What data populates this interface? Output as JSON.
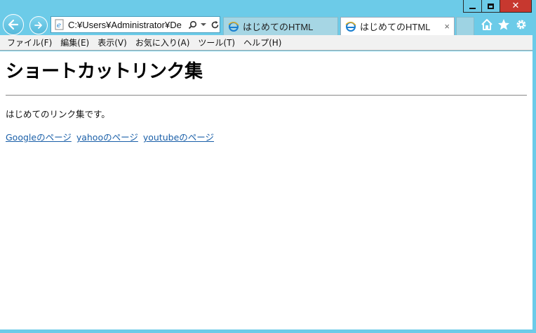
{
  "window": {
    "caption_buttons": [
      "minimize-icon",
      "maximize-icon",
      "close-icon"
    ]
  },
  "navigation": {
    "back_icon": "back-arrow-icon",
    "forward_icon": "forward-arrow-icon"
  },
  "address_bar": {
    "url": "C:¥Users¥Administrator¥De",
    "icons": [
      "ie-page-icon",
      "search-icon",
      "dropdown-icon",
      "refresh-icon"
    ]
  },
  "tabs": [
    {
      "label": "はじめてのHTML",
      "active": false
    },
    {
      "label": "はじめてのHTML",
      "active": true,
      "close": "×"
    }
  ],
  "toolbar": {
    "icons": [
      "home-icon",
      "favorites-star-icon",
      "settings-gear-icon"
    ]
  },
  "menu": [
    "ファイル(F)",
    "編集(E)",
    "表示(V)",
    "お気に入り(A)",
    "ツール(T)",
    "ヘルプ(H)"
  ],
  "page": {
    "heading": "ショートカットリンク集",
    "intro": "はじめてのリンク集です。",
    "links": [
      "Googleのページ",
      "yahooのページ",
      "youtubeのページ"
    ]
  },
  "colors": {
    "chrome": "#6ccbe8",
    "close_button": "#c7382f",
    "link": "#1a5fa8"
  }
}
